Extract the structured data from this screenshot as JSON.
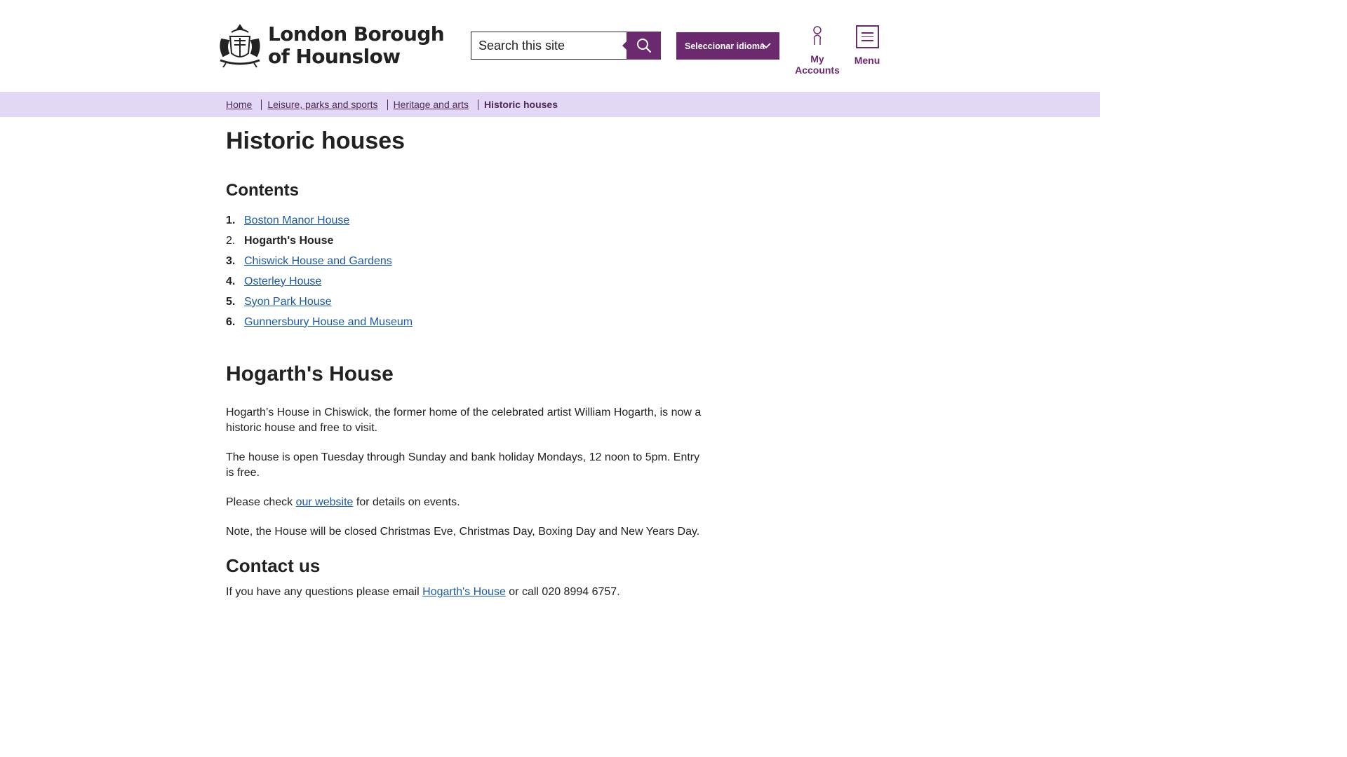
{
  "header": {
    "logo_line1": "London Borough",
    "logo_line2": "of Hounslow",
    "search_placeholder": "Search this site",
    "language_label": "Seleccionar idioma",
    "accounts_label": "My Accounts",
    "menu_label": "Menu"
  },
  "breadcrumb": {
    "items": [
      "Home",
      "Leisure, parks and sports",
      "Heritage and arts"
    ],
    "current": "Historic houses"
  },
  "page": {
    "title": "Historic houses",
    "contents_heading": "Contents",
    "toc": [
      {
        "num": "1.",
        "label": "Boston Manor House"
      },
      {
        "num": "2.",
        "label": "Hogarth's House"
      },
      {
        "num": "3.",
        "label": "Chiswick House and Gardens"
      },
      {
        "num": "4.",
        "label": "Osterley House"
      },
      {
        "num": "5.",
        "label": "Syon Park House"
      },
      {
        "num": "6.",
        "label": "Gunnersbury House and Museum"
      }
    ],
    "section_title": "Hogarth's House",
    "para1": "Hogarth’s House in Chiswick, the former home of the celebrated artist William Hogarth, is now a historic house and free to visit.",
    "para2": "The house is open Tuesday through Sunday and bank holiday Mondays, 12 noon to 5pm. Entry is free.",
    "para3_before": "Please check ",
    "para3_link": "our website",
    "para3_after": " for details on events.",
    "para4": "Note, the House will be closed Christmas Eve, Christmas Day, Boxing Day and New Years Day.",
    "contact_title": "Contact us",
    "contact_before": "If you have any questions please email ",
    "contact_link": "Hogarth's House",
    "contact_after": " or call 020 8994 6757."
  },
  "colors": {
    "brand_purple": "#6b2a6e",
    "breadcrumb_bg": "#e2d7f4",
    "link_blue": "#1d5aa0"
  }
}
